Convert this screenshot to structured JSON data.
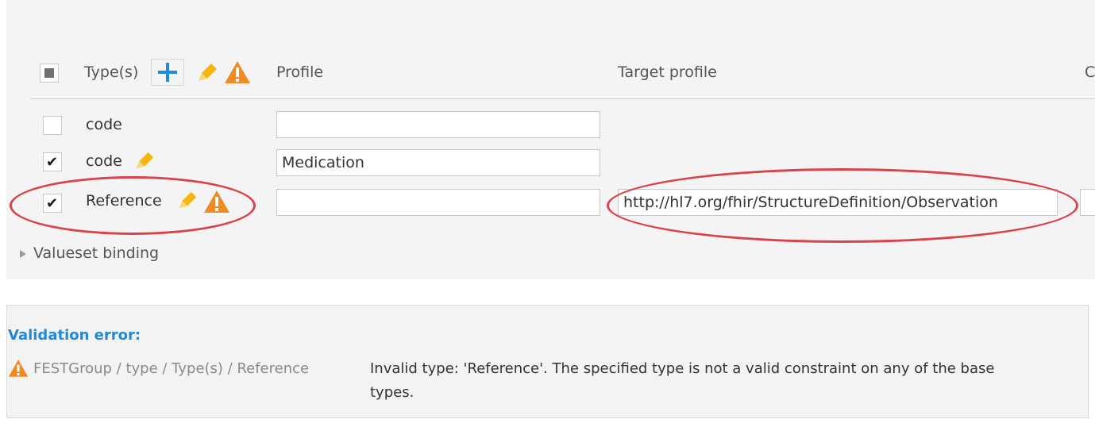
{
  "type_panel": {
    "header": {
      "types_label": "Type(s)",
      "profile_label": "Profile",
      "target_profile_label": "Target profile",
      "cut_label": "C"
    },
    "rows": [
      {
        "checked": false,
        "type": "code",
        "profile": "",
        "target_profile": null
      },
      {
        "checked": true,
        "type": "code",
        "profile": "Medication",
        "target_profile": null
      },
      {
        "checked": true,
        "type": "Reference",
        "profile": "",
        "target_profile": "http://hl7.org/fhir/StructureDefinition/Observation"
      }
    ],
    "valueset_binding_label": "Valueset binding"
  },
  "validation": {
    "title": "Validation error:",
    "path": "FESTGroup / type / Type(s) / Reference",
    "message_line1": "Invalid type: 'Reference'. The specified type is not a valid constraint on any of the base",
    "message_line2": "types."
  },
  "colors": {
    "accent_blue": "#1f8ad8",
    "warning_orange": "#f08a24",
    "pencil_yellow": "#f5b614",
    "annotation_red": "#d9434a"
  },
  "icons": {
    "add": "plus-icon",
    "edit": "pencil-icon",
    "warning": "warning-icon",
    "expand": "triangle-right-icon"
  }
}
